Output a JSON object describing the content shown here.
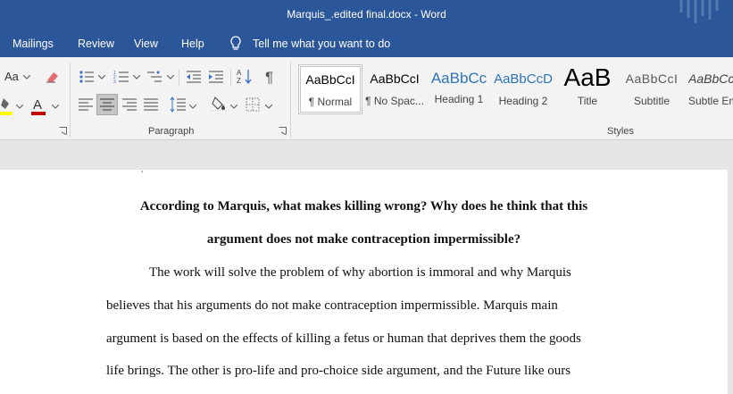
{
  "window": {
    "title": "Marquis_.edited final.docx  -  Word"
  },
  "menu": {
    "tabs": [
      "Mailings",
      "Review",
      "View",
      "Help"
    ],
    "tell_me": "Tell me what you want to do"
  },
  "ribbon": {
    "font": {
      "change_case": "Aa"
    },
    "paragraph": {
      "label": "Paragraph"
    },
    "styles": {
      "label": "Styles",
      "items": [
        {
          "sample": "AaBbCcI",
          "name": "¶ Normal",
          "color": "#000000"
        },
        {
          "sample": "AaBbCcI",
          "name": "¶ No Spac...",
          "color": "#000000"
        },
        {
          "sample": "AaBbCc",
          "name": "Heading 1",
          "color": "#2e74b5"
        },
        {
          "sample": "AaBbCcD",
          "name": "Heading 2",
          "color": "#2e74b5"
        },
        {
          "sample": "AaB",
          "name": "Title",
          "color": "#000000"
        },
        {
          "sample": "AaBbCcI",
          "name": "Subtitle",
          "color": "#595959"
        },
        {
          "sample": "AaBbCcI",
          "name": "Subtle Em",
          "color": "#404040"
        }
      ]
    }
  },
  "colors": {
    "word_blue": "#2b579a",
    "highlight": "#ffff00",
    "font_color": "#c00000"
  },
  "document": {
    "heading": [
      "According to Marquis, what makes killing wrong? Why does he think that this",
      "argument does not make contraception impermissible?"
    ],
    "body": [
      "The work will solve the problem of why abortion is immoral and why Marquis",
      "believes that his arguments do not make contraception impermissible.  Marquis main",
      "argument is based on the effects of killing a fetus or human that deprives them the goods",
      "life brings. The other is pro-life and pro-choice side argument, and the Future like ours"
    ]
  }
}
